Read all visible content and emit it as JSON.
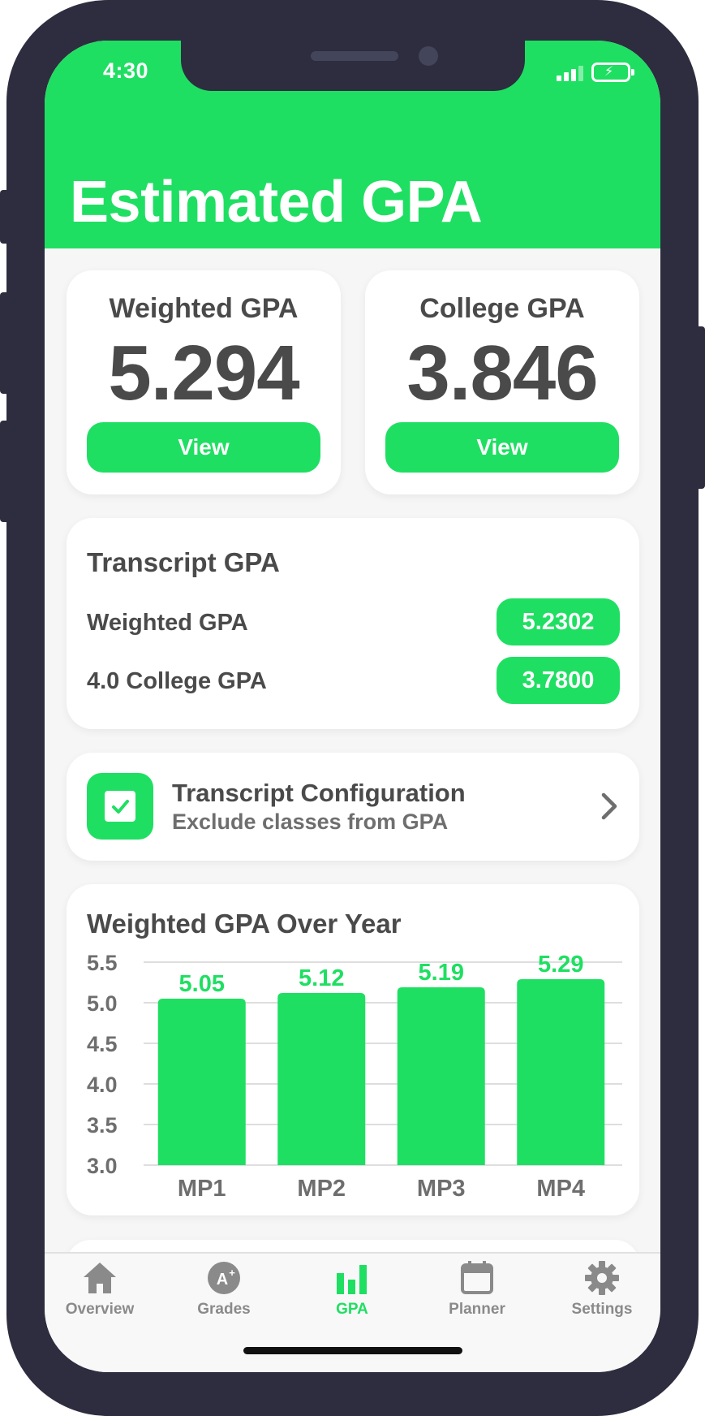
{
  "status_bar": {
    "time": "4:30"
  },
  "header": {
    "title": "Estimated GPA"
  },
  "gpa_cards": [
    {
      "label": "Weighted GPA",
      "value": "5.294",
      "button": "View"
    },
    {
      "label": "College GPA",
      "value": "3.846",
      "button": "View"
    }
  ],
  "transcript": {
    "title": "Transcript GPA",
    "rows": [
      {
        "label": "Weighted GPA",
        "value": "5.2302"
      },
      {
        "label": "4.0 College GPA",
        "value": "3.7800"
      }
    ]
  },
  "config": {
    "title": "Transcript Configuration",
    "subtitle": "Exclude classes from GPA",
    "icon": "check-icon"
  },
  "chart": {
    "title": "Weighted GPA Over Year"
  },
  "chart_data": {
    "type": "bar",
    "title": "Weighted GPA Over Year",
    "categories": [
      "MP1",
      "MP2",
      "MP3",
      "MP4"
    ],
    "values": [
      5.05,
      5.12,
      5.19,
      5.29
    ],
    "data_labels": [
      "5.05",
      "5.12",
      "5.19",
      "5.29"
    ],
    "yticks": [
      "3.0",
      "3.5",
      "4.0",
      "4.5",
      "5.0",
      "5.5"
    ],
    "ylim": [
      3.0,
      5.5
    ],
    "grid": true,
    "bar_color": "#1fdf62",
    "label_color": "#1fdf62"
  },
  "tabs": [
    {
      "label": "Overview",
      "icon": "home-icon",
      "active": false
    },
    {
      "label": "Grades",
      "icon": "grade-badge-icon",
      "active": false
    },
    {
      "label": "GPA",
      "icon": "bar-chart-icon",
      "active": true
    },
    {
      "label": "Planner",
      "icon": "calendar-icon",
      "active": false
    },
    {
      "label": "Settings",
      "icon": "gear-icon",
      "active": false
    }
  ],
  "colors": {
    "accent": "#1fdf62",
    "frame": "#2d2d3f",
    "text": "#4a4a4a",
    "inactive": "#8a8a8a"
  }
}
